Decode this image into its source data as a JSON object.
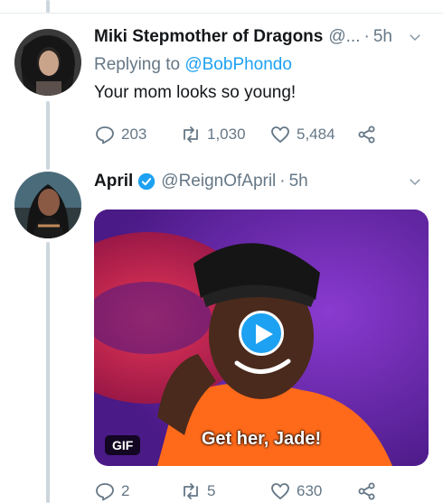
{
  "colors": {
    "accent": "#1da1f2",
    "muted": "#657786",
    "thread_line": "#ccd6dd",
    "verified": "#1da1f2"
  },
  "tweet1": {
    "display_name": "Miki Stepmother of Dragons",
    "handle": "@...",
    "time": "5h",
    "replying_prefix": "Replying to",
    "replying_to": "@BobPhondo",
    "text": "Your mom looks so young!",
    "replies": "203",
    "retweets": "1,030",
    "likes": "5,484"
  },
  "tweet2": {
    "display_name": "April",
    "handle": "@ReignOfApril",
    "time": "5h",
    "media": {
      "badge": "GIF",
      "caption": "Get her, Jade!"
    },
    "replies": "2",
    "retweets": "5",
    "likes": "630"
  }
}
